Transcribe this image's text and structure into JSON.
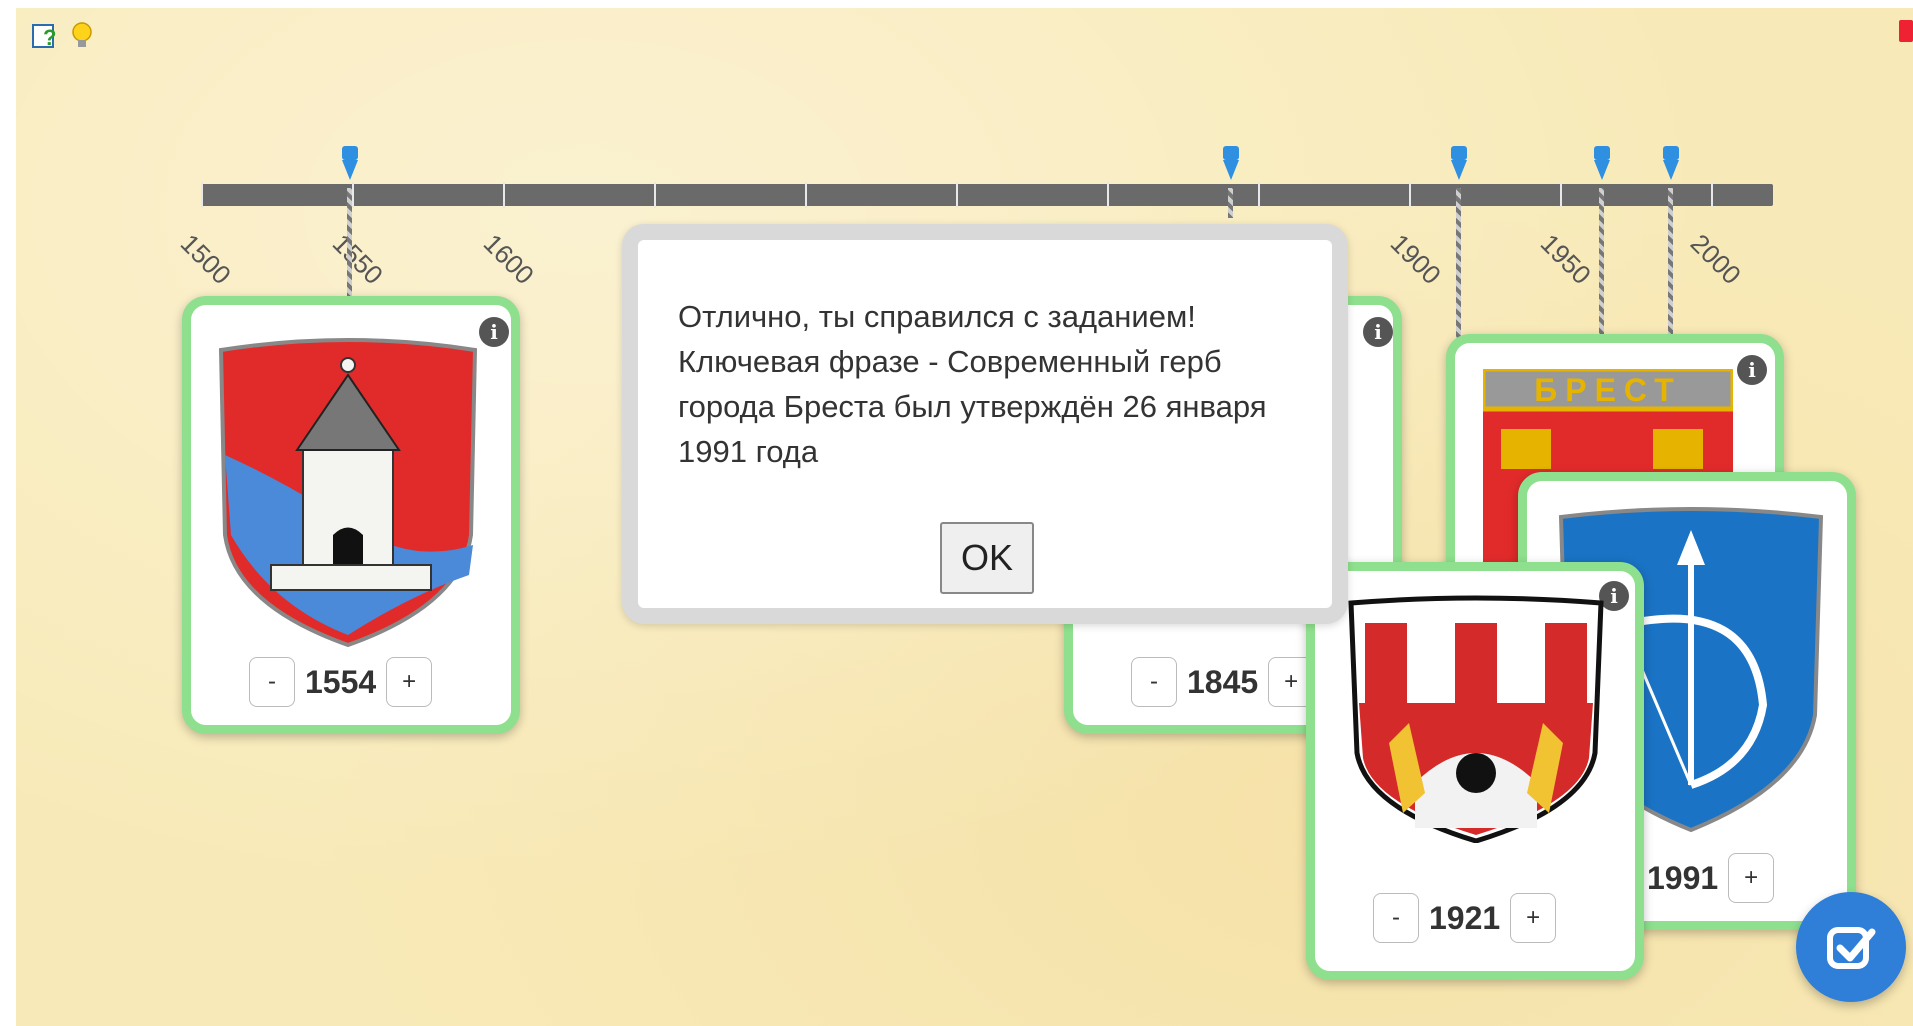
{
  "toolbar": {
    "help_icon": "help-icon",
    "hint_icon": "lightbulb-icon"
  },
  "timeline": {
    "tick_labels": [
      "1500",
      "1550",
      "1600",
      "1900",
      "1950",
      "2000"
    ]
  },
  "cards": [
    {
      "year": "1554",
      "minus": "-",
      "plus": "+"
    },
    {
      "year": "1845",
      "minus": "-",
      "plus": "+"
    },
    {
      "year": "1921",
      "minus": "-",
      "plus": "+"
    },
    {
      "year": "1991",
      "minus": "-",
      "plus": "+"
    }
  ],
  "modal": {
    "message": "Отлично, ты справился с заданием! Ключевая фразе - Современный герб города Бреста был утверждён 26 января 1991 года",
    "ok_label": "OK"
  },
  "emblem_text": "БРЕСТ",
  "colors": {
    "card_border": "#8ee08e",
    "marker": "#2f8fe0",
    "check_button": "#2f7ed8",
    "background": "#f8eab8"
  }
}
